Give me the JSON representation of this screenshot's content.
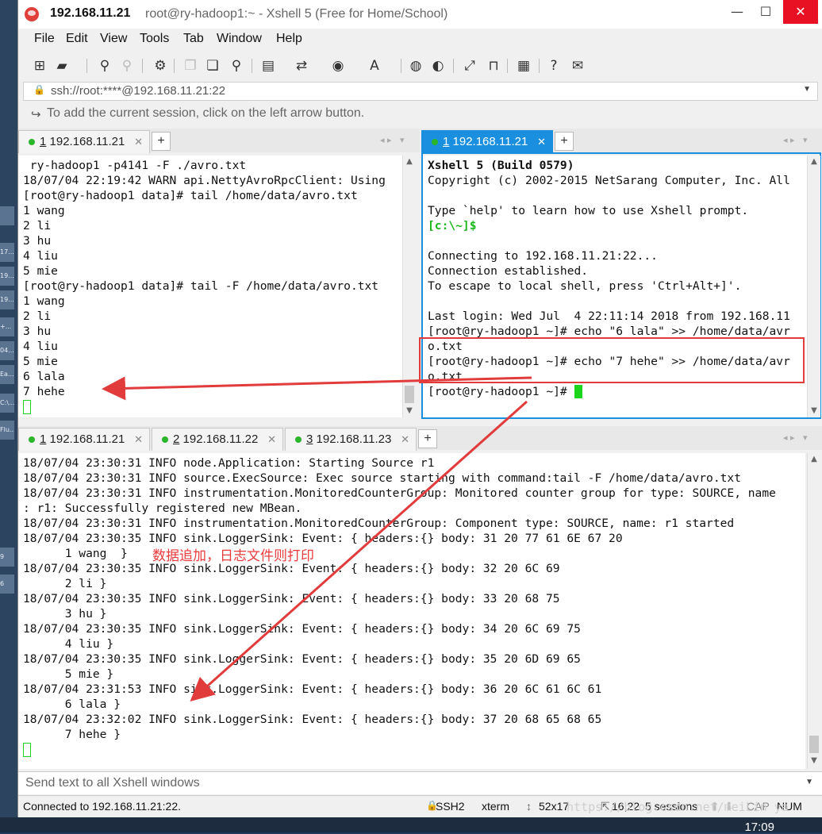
{
  "window": {
    "title_ip": "192.168.11.21",
    "title_rest": "root@ry-hadoop1:~ - Xshell 5 (Free for Home/School)",
    "minimize": "—",
    "maximize": "☐",
    "close": "✕"
  },
  "menu": [
    "File",
    "Edit",
    "View",
    "Tools",
    "Tab",
    "Window",
    "Help"
  ],
  "toolbar_icons": [
    "new-session-icon",
    "open-folder-icon",
    "reconnect-icon",
    "disconnect-icon",
    "properties-icon",
    "copy-icon",
    "paste-icon",
    "find-icon",
    "print-icon",
    "transfer-icon",
    "globe-icon",
    "font-icon",
    "xftp-icon",
    "xshell-icon",
    "fullscreen-icon",
    "lock-icon",
    "keyboard-icon",
    "help-icon",
    "chat-icon"
  ],
  "address": {
    "text": "ssh://root:****@192.168.11.21:22"
  },
  "hint": {
    "text": "To add the current session, click on the left arrow button."
  },
  "top_left_pane": {
    "tab": {
      "num": "1",
      "label": " 192.168.11.21"
    },
    "lines": [
      " ry-hadoop1 -p4141 -F ./avro.txt",
      "18/07/04 22:19:42 WARN api.NettyAvroRpcClient: Using",
      "[root@ry-hadoop1 data]# tail /home/data/avro.txt",
      "1 wang",
      "2 li",
      "3 hu",
      "4 liu",
      "5 mie",
      "[root@ry-hadoop1 data]# tail -F /home/data/avro.txt",
      "1 wang",
      "2 li",
      "3 hu",
      "4 liu",
      "5 mie",
      "6 lala",
      "7 hehe"
    ]
  },
  "top_right_pane": {
    "tab": {
      "num": "1",
      "label": " 192.168.11.21"
    },
    "banner": "Xshell 5 (Build 0579)",
    "lines": [
      "Copyright (c) 2002-2015 NetSarang Computer, Inc. All",
      "",
      "Type `help' to learn how to use Xshell prompt.",
      "",
      "",
      "Connecting to 192.168.11.21:22...",
      "Connection established.",
      "To escape to local shell, press 'Ctrl+Alt+]'.",
      "",
      "Last login: Wed Jul  4 22:11:14 2018 from 192.168.11",
      "[root@ry-hadoop1 ~]# echo \"6 lala\" >> /home/data/avr",
      "o.txt",
      "[root@ry-hadoop1 ~]# echo \"7 hehe\" >> /home/data/avr",
      "o.txt",
      "[root@ry-hadoop1 ~]# "
    ],
    "local_prompt": "[c:\\~]$"
  },
  "bottom_pane": {
    "tabs": [
      {
        "num": "1",
        "label": " 192.168.11.21"
      },
      {
        "num": "2",
        "label": " 192.168.11.22"
      },
      {
        "num": "3",
        "label": " 192.168.11.23"
      }
    ],
    "lines": [
      "18/07/04 23:30:31 INFO node.Application: Starting Source r1",
      "18/07/04 23:30:31 INFO source.ExecSource: Exec source starting with command:tail -F /home/data/avro.txt",
      "18/07/04 23:30:31 INFO instrumentation.MonitoredCounterGroup: Monitored counter group for type: SOURCE, name",
      ": r1: Successfully registered new MBean.",
      "18/07/04 23:30:31 INFO instrumentation.MonitoredCounterGroup: Component type: SOURCE, name: r1 started",
      "18/07/04 23:30:35 INFO sink.LoggerSink: Event: { headers:{} body: 31 20 77 61 6E 67 20",
      "      1 wang  }",
      "18/07/04 23:30:35 INFO sink.LoggerSink: Event: { headers:{} body: 32 20 6C 69",
      "      2 li }",
      "18/07/04 23:30:35 INFO sink.LoggerSink: Event: { headers:{} body: 33 20 68 75",
      "      3 hu }",
      "18/07/04 23:30:35 INFO sink.LoggerSink: Event: { headers:{} body: 34 20 6C 69 75",
      "      4 liu }",
      "18/07/04 23:30:35 INFO sink.LoggerSink: Event: { headers:{} body: 35 20 6D 69 65",
      "      5 mie }",
      "18/07/04 23:31:53 INFO sink.LoggerSink: Event: { headers:{} body: 36 20 6C 61 6C 61",
      "      6 lala }",
      "18/07/04 23:32:02 INFO sink.LoggerSink: Event: { headers:{} body: 37 20 68 65 68 65",
      "      7 hehe }"
    ],
    "annotation": "数据追加，日志文件则打印"
  },
  "send_bar": {
    "placeholder": "Send text to all Xshell windows"
  },
  "status": {
    "connected": "Connected to 192.168.11.21:22.",
    "protocol": "SSH2",
    "term": "xterm",
    "size": "52x17",
    "pos": "16,22",
    "sessions": "5 sessions",
    "cap": "CAP",
    "num": "NUM"
  },
  "watermark": "https://blog.csdn.net/meiLin ya",
  "clock": "17:09",
  "desktop_tiles": [
    "17...",
    "19...",
    "19...",
    "+...",
    "04...",
    "Ea...",
    "C:\\...",
    "Flu...",
    "9",
    "6"
  ],
  "colors": {
    "accent_blue": "#1a8fe0",
    "green": "#1bd41b",
    "red_annotation": "#e23b3b",
    "close_red": "#e81123"
  }
}
